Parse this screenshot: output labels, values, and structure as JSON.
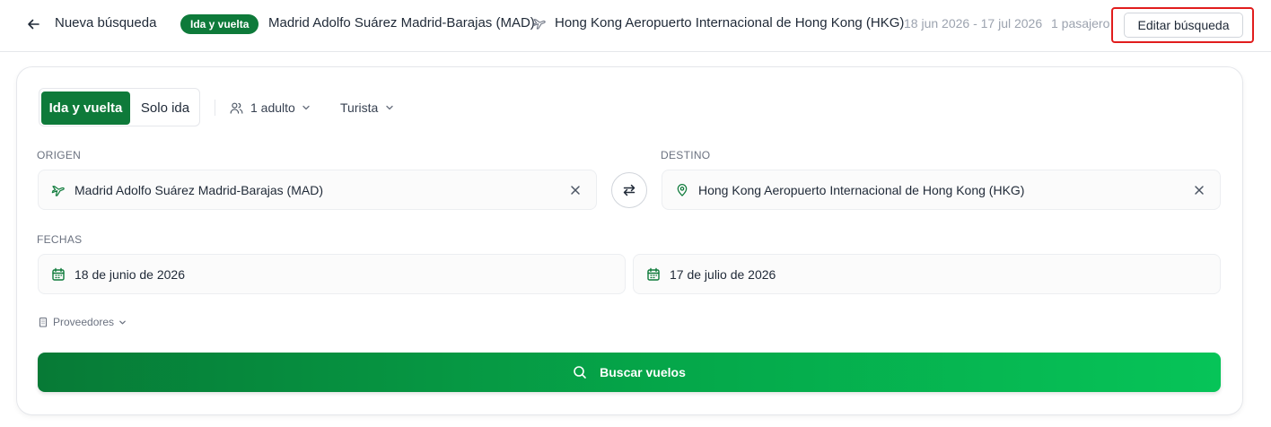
{
  "header": {
    "back_label": "Nueva búsqueda",
    "trip_type_badge": "Ida y vuelta",
    "origin": "Madrid Adolfo Suárez Madrid-Barajas (MAD)",
    "destination": "Hong Kong Aeropuerto Internacional de Hong Kong (HKG)",
    "dates": "18 jun 2026 - 17 jul 2026",
    "passengers": "1 pasajero",
    "edit_label": "Editar búsqueda"
  },
  "form": {
    "trip_types": [
      "Ida y vuelta",
      "Solo ida"
    ],
    "selected_trip_type": "Ida y vuelta",
    "passengers": "1 adulto",
    "cabin_class": "Turista",
    "origin_label": "ORIGEN",
    "origin_value": "Madrid Adolfo Suárez Madrid-Barajas (MAD)",
    "destination_label": "DESTINO",
    "destination_value": "Hong Kong Aeropuerto Internacional de Hong Kong (HKG)",
    "dates_label": "FECHAS",
    "departure_date": "18 de junio de 2026",
    "return_date": "17 de julio de 2026",
    "providers_label": "Proveedores",
    "search_label": "Buscar vuelos"
  },
  "colors": {
    "brand_green": "#0e7a3a",
    "highlight_red": "#e11d1d"
  },
  "icons": {
    "back": "arrow-left-icon",
    "plane": "plane-icon",
    "users": "users-icon",
    "chevron": "chevron-down-icon",
    "location": "map-pin-icon",
    "calendar": "calendar-icon",
    "swap": "swap-arrows-icon",
    "clear": "close-icon",
    "building": "building-icon",
    "search": "search-icon"
  }
}
